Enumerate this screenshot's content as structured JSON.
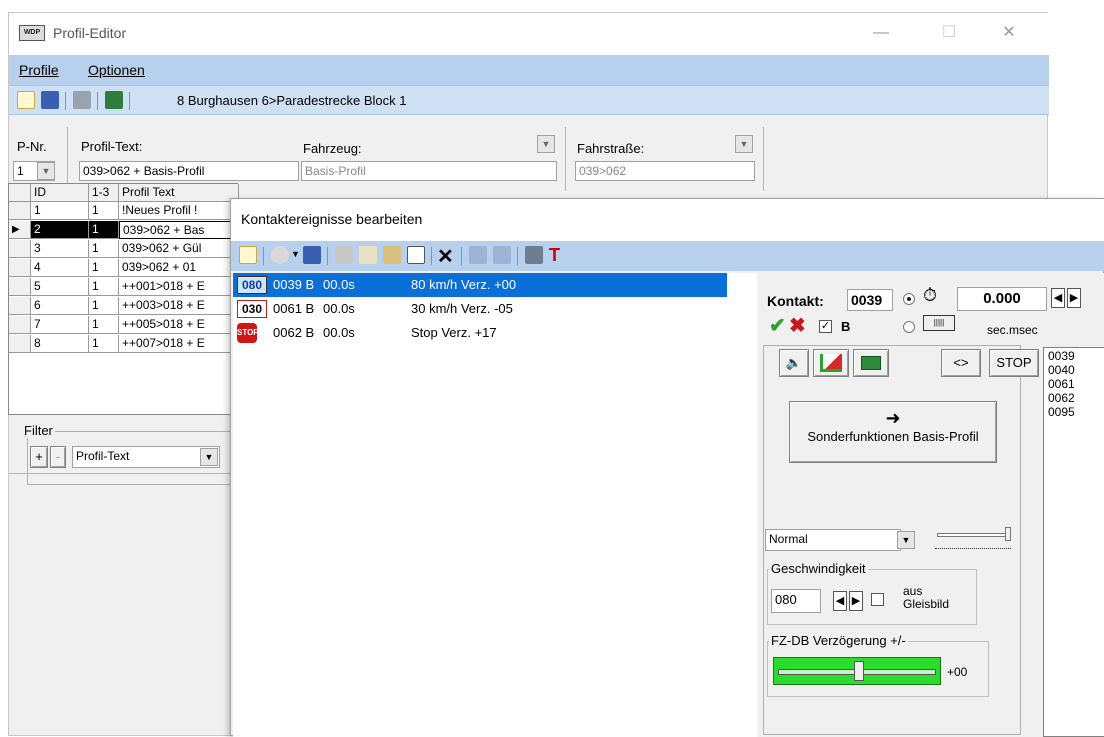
{
  "window": {
    "title": "Profil-Editor",
    "logo_text": "WDP",
    "controls": {
      "minimize": "—",
      "maximize": "☐",
      "close": "✕"
    }
  },
  "menu": {
    "items": [
      "Profile",
      "Optionen"
    ]
  },
  "toolbar": {
    "path": "8 Burghausen 6>Paradestrecke Block 1"
  },
  "header": {
    "pnr_label": "P-Nr.",
    "pnr_value": "1",
    "profiltext_label": "Profil-Text:",
    "profiltext_value": "039>062 + Basis-Profil",
    "fahrzeug_label": "Fahrzeug:",
    "fahrzeug_value": "Basis-Profil",
    "fahrstrasse_label": "Fahrstraße:",
    "fahrstrasse_value": "039>062"
  },
  "grid": {
    "columns": [
      "ID",
      "1-3",
      "Profil Text"
    ],
    "rows": [
      {
        "id": "1",
        "c": "1",
        "text": "!Neues Profil !"
      },
      {
        "id": "2",
        "c": "1",
        "text": "039>062 + Bas"
      },
      {
        "id": "3",
        "c": "1",
        "text": "039>062 + Gül"
      },
      {
        "id": "4",
        "c": "1",
        "text": "039>062 + 01"
      },
      {
        "id": "5",
        "c": "1",
        "text": "++001>018 + E"
      },
      {
        "id": "6",
        "c": "1",
        "text": "++003>018 + E"
      },
      {
        "id": "7",
        "c": "1",
        "text": "++005>018 + E"
      },
      {
        "id": "8",
        "c": "1",
        "text": "++007>018 + E"
      }
    ],
    "selected_row": "2"
  },
  "filter": {
    "label": "Filter",
    "plus": "+",
    "minus": "-",
    "select_value": "Profil-Text"
  },
  "dialog": {
    "title": "Kontaktereignisse bearbeiten",
    "events": [
      {
        "badge": "080",
        "contact": "0039 B",
        "time": "00.0s",
        "desc": "80 km/h Verz. +00"
      },
      {
        "badge": "030",
        "contact": "0061 B",
        "time": "00.0s",
        "desc": "30 km/h Verz. -05"
      },
      {
        "badge": "STOP",
        "contact": "0062 B",
        "time": "00.0s",
        "desc": "Stop Verz. +17"
      }
    ],
    "kontakt_label": "Kontakt:",
    "kontakt_value": "0039",
    "time_value": "0.000",
    "b_label": "B",
    "unit_label": "sec.msec",
    "stop_button": "STOP",
    "code_button": "<>",
    "contact_list": [
      "0039",
      "0040",
      "0061",
      "0062",
      "0095"
    ],
    "sonder_button": "Sonderfunktionen Basis-Profil",
    "mode_select": "Normal",
    "speed_group": "Geschwindigkeit",
    "speed_value": "080",
    "aus_label": "aus",
    "gleisbild_label": "Gleisbild",
    "fzdb_group": "FZ-DB Verzögerung +/-",
    "fzdb_value": "+00"
  }
}
